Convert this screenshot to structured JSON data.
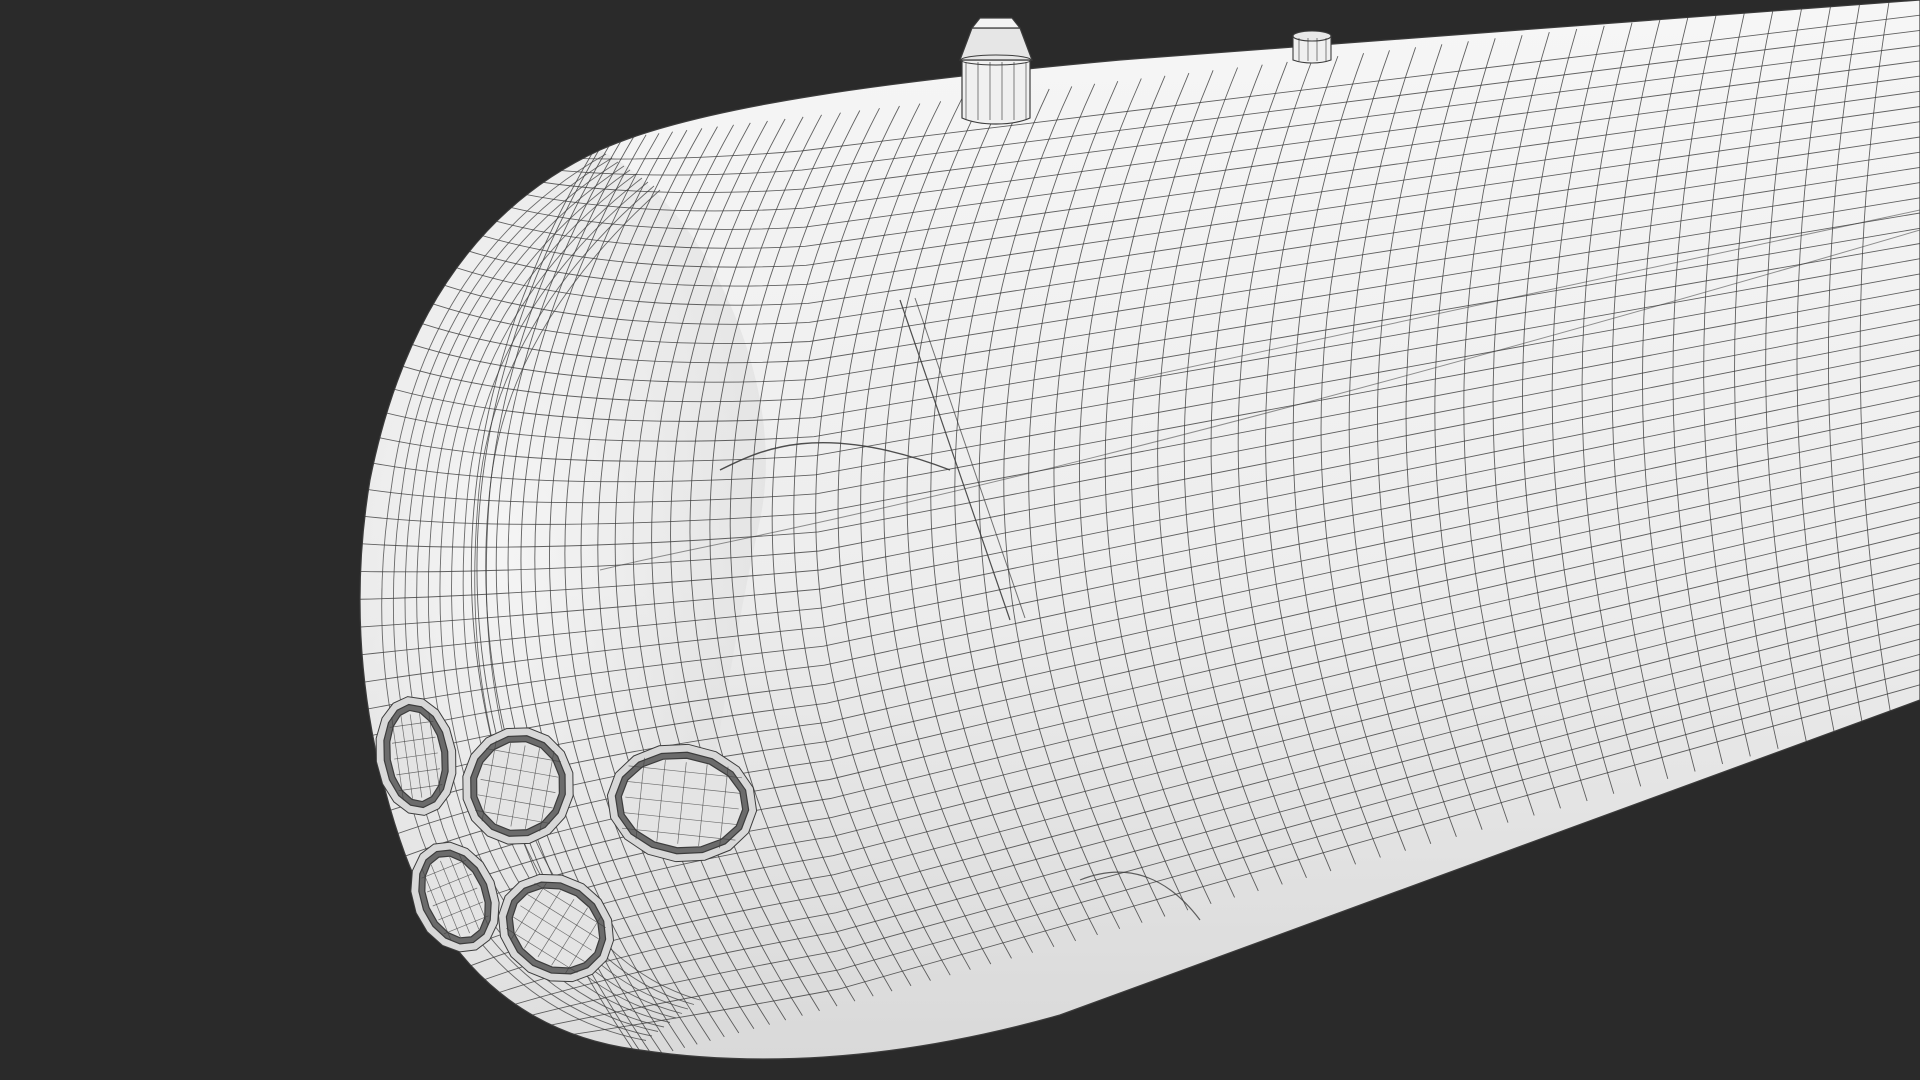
{
  "scene": {
    "background_color": "#2a2a2a",
    "mesh_fill_color": "#ececec",
    "mesh_line_color": "#3c3c3c",
    "port_ring_color": "#6b6b6b",
    "port_rim_color": "#d8d8d8",
    "subject": "wireframe-cylindrical-hull-render",
    "viewport_icon": "3d-wireframe-icon"
  }
}
